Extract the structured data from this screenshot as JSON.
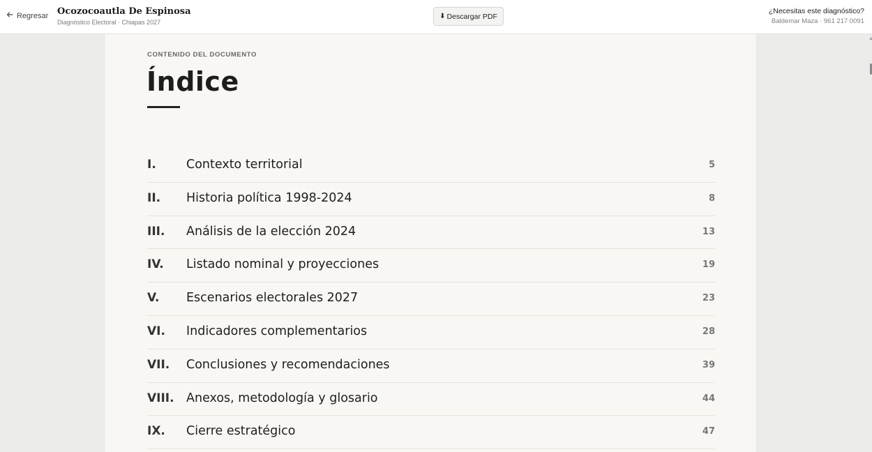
{
  "topbar": {
    "back_label": "Regresar",
    "doc_title": "Ocozocoautla De Espinosa",
    "doc_subtitle": "Diagnóstico Electoral · Chiapas 2027",
    "pdf_button_icon": "⬇",
    "pdf_button_label": "Descargar PDF",
    "contact_question": "¿Necesitas este diagnóstico?",
    "contact_details": "Baldemar Maza · 961 217 0091"
  },
  "page": {
    "eyebrow": "CONTENIDO DEL DOCUMENTO",
    "heading": "Índice",
    "toc": [
      {
        "num": "I.",
        "title": "Contexto territorial",
        "page": "5"
      },
      {
        "num": "II.",
        "title": "Historia política 1998-2024",
        "page": "8"
      },
      {
        "num": "III.",
        "title": "Análisis de la elección 2024",
        "page": "13"
      },
      {
        "num": "IV.",
        "title": "Listado nominal y proyecciones",
        "page": "19"
      },
      {
        "num": "V.",
        "title": "Escenarios electorales 2027",
        "page": "23"
      },
      {
        "num": "VI.",
        "title": "Indicadores complementarios",
        "page": "28"
      },
      {
        "num": "VII.",
        "title": "Conclusiones y recomendaciones",
        "page": "39"
      },
      {
        "num": "VIII.",
        "title": "Anexos, metodología y glosario",
        "page": "44"
      },
      {
        "num": "IX.",
        "title": "Cierre estratégico",
        "page": "47"
      }
    ]
  }
}
